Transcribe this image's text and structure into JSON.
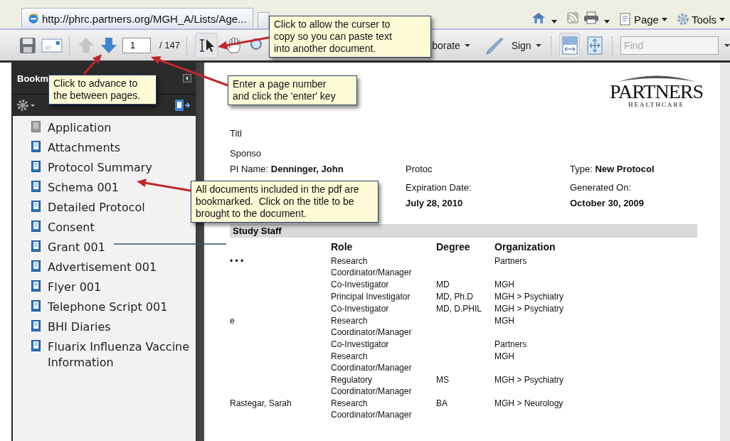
{
  "browser": {
    "url": "http://phrc.partners.org/MGH_A/Lists/Age...",
    "commands": [
      {
        "label": "Page"
      },
      {
        "label": "Tools"
      }
    ]
  },
  "toolbar": {
    "previous_page": {
      "disabled": true
    },
    "next_page": {
      "disabled": false
    },
    "page": "1",
    "total": "/ 147",
    "tools": [
      {
        "kind": "select",
        "selected": true
      },
      {
        "kind": "hand",
        "selected": false
      }
    ],
    "collaborate": "borate",
    "sign": "Sign",
    "views": [
      {
        "kind": "fit-width",
        "selected": true
      },
      {
        "kind": "fit-page",
        "selected": false
      }
    ],
    "find": {
      "placeholder": "Find"
    }
  },
  "sidebar": {
    "title": "Bookm",
    "bookmarks": [
      {
        "label": "Application",
        "kind": "blank"
      },
      {
        "label": "Attachments",
        "kind": "page"
      },
      {
        "label": "Protocol Summary",
        "kind": "page"
      },
      {
        "label": "Schema 001",
        "kind": "page"
      },
      {
        "label": "Detailed Protocol",
        "kind": "page"
      },
      {
        "label": "Consent",
        "kind": "page"
      },
      {
        "label": "Grant 001",
        "kind": "page"
      },
      {
        "label": "Advertisement 001",
        "kind": "page"
      },
      {
        "label": "Flyer 001",
        "kind": "page"
      },
      {
        "label": "Telephone Script 001",
        "kind": "page"
      },
      {
        "label": "BHI Diaries",
        "kind": "page"
      },
      {
        "label": "Fluarix Influenza Vaccine Information",
        "kind": "page"
      }
    ]
  },
  "document": {
    "logo": {
      "name": "PARTNERS",
      "tagline": "HEALTHCARE"
    },
    "title": "Titl",
    "sponsor": "Sponso",
    "pi": {
      "label": "PI Name:",
      "value": "Denninger, John"
    },
    "protocol": "Protoc",
    "type": {
      "label": "Type:",
      "value": "New Protocol"
    },
    "expiration": {
      "label": "Expiration Date:",
      "value": "July 28, 2010"
    },
    "generated": {
      "label": "Generated On:",
      "value": "October 30, 2009"
    },
    "section": "Study Staff",
    "table": {
      "columns": [
        "Role",
        "Degree",
        "Organization"
      ],
      "rows": [
        {
          "name": "• • •",
          "role": "Research Coordinator/Manager",
          "organization": "Partners"
        },
        {
          "role": "Co-Investigator",
          "degree": "MD",
          "organization": "MGH"
        },
        {
          "role": "Principal Investigator",
          "degree": "MD, Ph.D",
          "organization": "MGH > Psychiatry"
        },
        {
          "role": "Co-Investigator",
          "degree": "MD, D.PHIL",
          "organization": "MGH > Psychiatry"
        },
        {
          "name": "e",
          "role": "Research Coordinator/Manager",
          "organization": "MGH"
        },
        {
          "role": "Co-Investigator",
          "organization": "Partners"
        },
        {
          "role": "Research Coordinator/Manager",
          "organization": "MGH"
        },
        {
          "role": "Regulatory Coordinator/Manager",
          "degree": "MS",
          "organization": "MGH > Psychiatry"
        },
        {
          "name": "Rastegar, Sarah",
          "role": "Research Coordinator/Manager",
          "degree": "BA",
          "organization": "MGH > Neurology"
        }
      ]
    }
  },
  "callouts": [
    {
      "text": "Click to allow the curser to copy so you can paste text into another document."
    },
    {
      "text": "Click to advance to the between pages."
    },
    {
      "text": "Enter a page number and click the 'enter' key"
    },
    {
      "text": "All documents included in the pdf are bookmarked.  Click on the title to be brought to the document."
    }
  ]
}
